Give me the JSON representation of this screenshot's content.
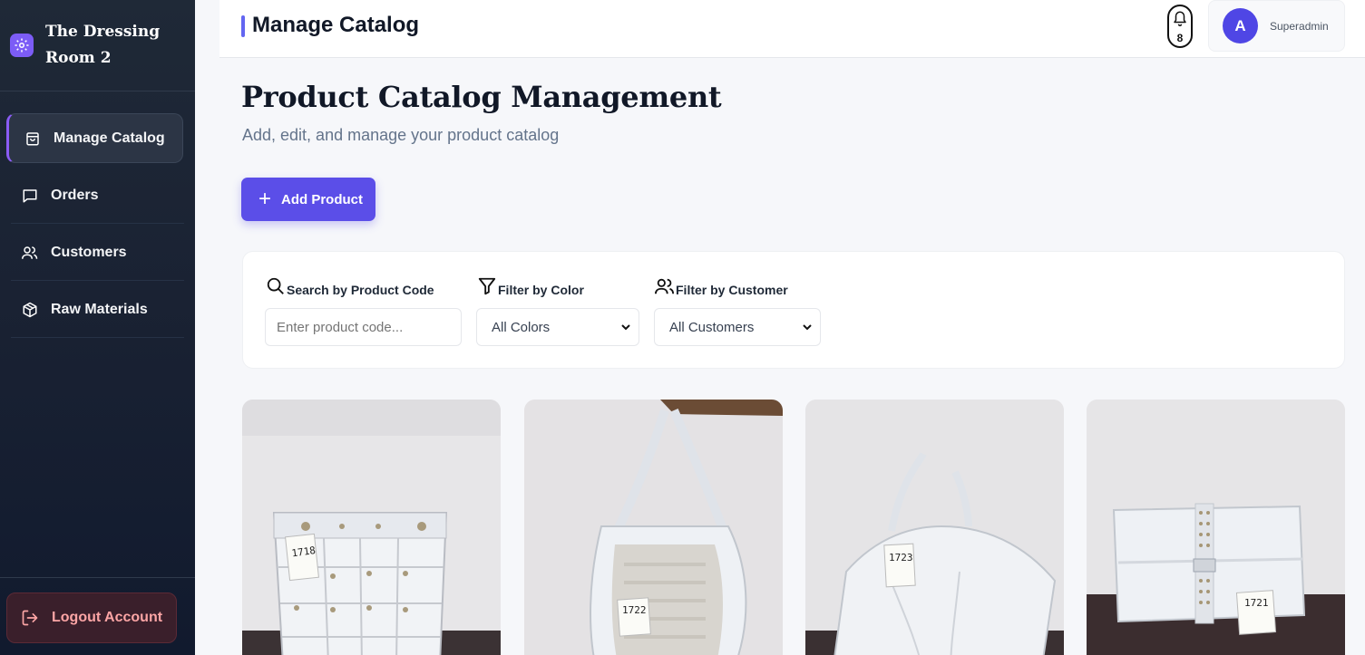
{
  "brand": {
    "name": "The Dressing Room 2"
  },
  "sidebar": {
    "items": [
      {
        "label": "Manage Catalog",
        "icon": "shopping-bag-icon",
        "active": true
      },
      {
        "label": "Orders",
        "icon": "message-square-icon",
        "active": false
      },
      {
        "label": "Customers",
        "icon": "users-icon",
        "active": false
      },
      {
        "label": "Raw Materials",
        "icon": "package-icon",
        "active": false
      }
    ],
    "logout_label": "Logout Account"
  },
  "header": {
    "title": "Manage Catalog",
    "notification_count": "8",
    "user_initial": "A",
    "user_name": "Superadmin"
  },
  "main": {
    "title": "Product Catalog Management",
    "subtitle": "Add, edit, and manage your product catalog",
    "add_button_label": "Add Product"
  },
  "filters": {
    "search": {
      "label": "Search by Product Code",
      "placeholder": "Enter product code...",
      "value": ""
    },
    "color": {
      "label": "Filter by Color",
      "selected": "All Colors"
    },
    "customer": {
      "label": "Filter by Customer",
      "selected": "All Customers"
    }
  },
  "products": [
    {
      "tag": "1718",
      "image": "white studded woven leather bucket bag"
    },
    {
      "tag": "1722",
      "image": "white hobo shoulder bag with woven panel"
    },
    {
      "tag": "1723",
      "image": "white slouchy drawstring handbag"
    },
    {
      "tag": "1721",
      "image": "white studded clutch bag"
    }
  ],
  "colors": {
    "accent": "#5b4ee8",
    "sidebar_bg": "#1a2233",
    "logout_text": "#fca5a5"
  }
}
